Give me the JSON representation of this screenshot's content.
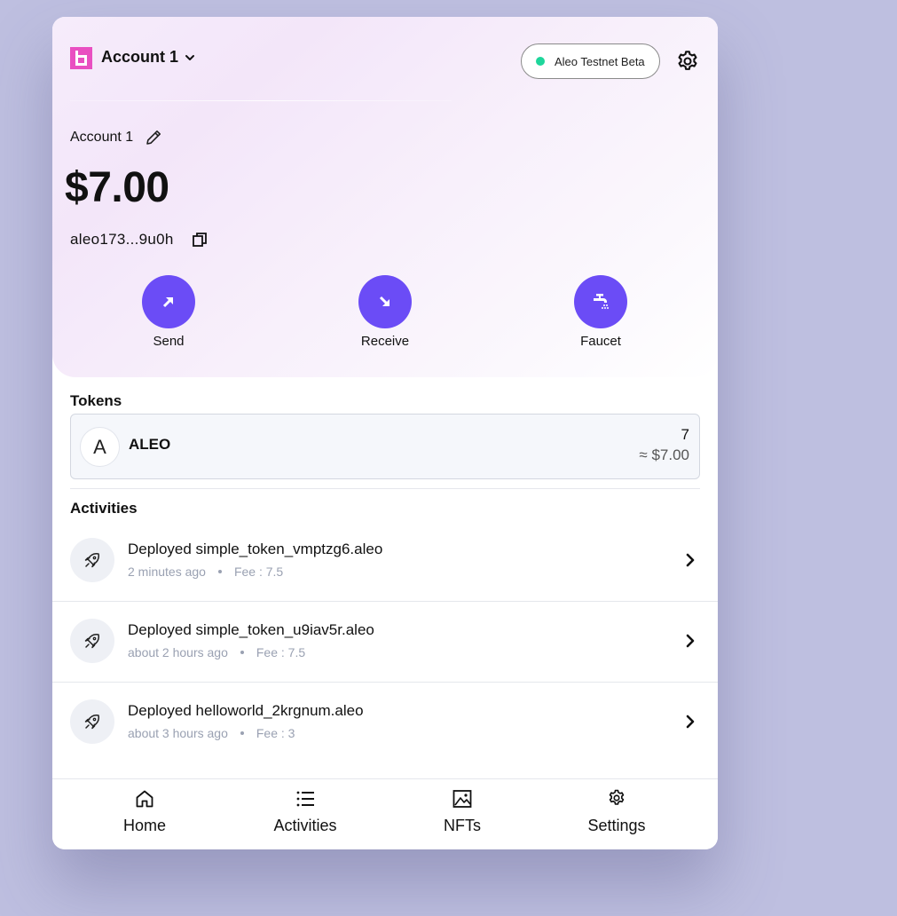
{
  "header": {
    "account_name": "Account 1",
    "network": "Aleo Testnet Beta",
    "network_status_color": "#1ed69b"
  },
  "account": {
    "label": "Account 1",
    "balance": "$7.00",
    "address": "aleo173...9u0h"
  },
  "actions": [
    {
      "label": "Send",
      "icon": "arrow-up-right-icon"
    },
    {
      "label": "Receive",
      "icon": "arrow-down-right-icon"
    },
    {
      "label": "Faucet",
      "icon": "faucet-icon"
    }
  ],
  "tokens": {
    "title": "Tokens",
    "items": [
      {
        "symbol": "ALEO",
        "icon_glyph": "A",
        "amount": "7",
        "usd": "≈ $7.00"
      }
    ]
  },
  "activities": {
    "title": "Activities",
    "items": [
      {
        "title": "Deployed simple_token_vmptzg6.aleo",
        "time": "2 minutes ago",
        "fee": "Fee : 7.5"
      },
      {
        "title": "Deployed simple_token_u9iav5r.aleo",
        "time": "about 2 hours ago",
        "fee": "Fee : 7.5"
      },
      {
        "title": "Deployed helloworld_2krgnum.aleo",
        "time": "about 3 hours ago",
        "fee": "Fee : 3"
      }
    ]
  },
  "nav": [
    {
      "label": "Home",
      "icon": "home-icon"
    },
    {
      "label": "Activities",
      "icon": "list-icon"
    },
    {
      "label": "NFTs",
      "icon": "image-icon"
    },
    {
      "label": "Settings",
      "icon": "gear-icon"
    }
  ],
  "colors": {
    "accent": "#6b4cf6",
    "logo": "#e94fc1",
    "background": "#bebfe0"
  }
}
